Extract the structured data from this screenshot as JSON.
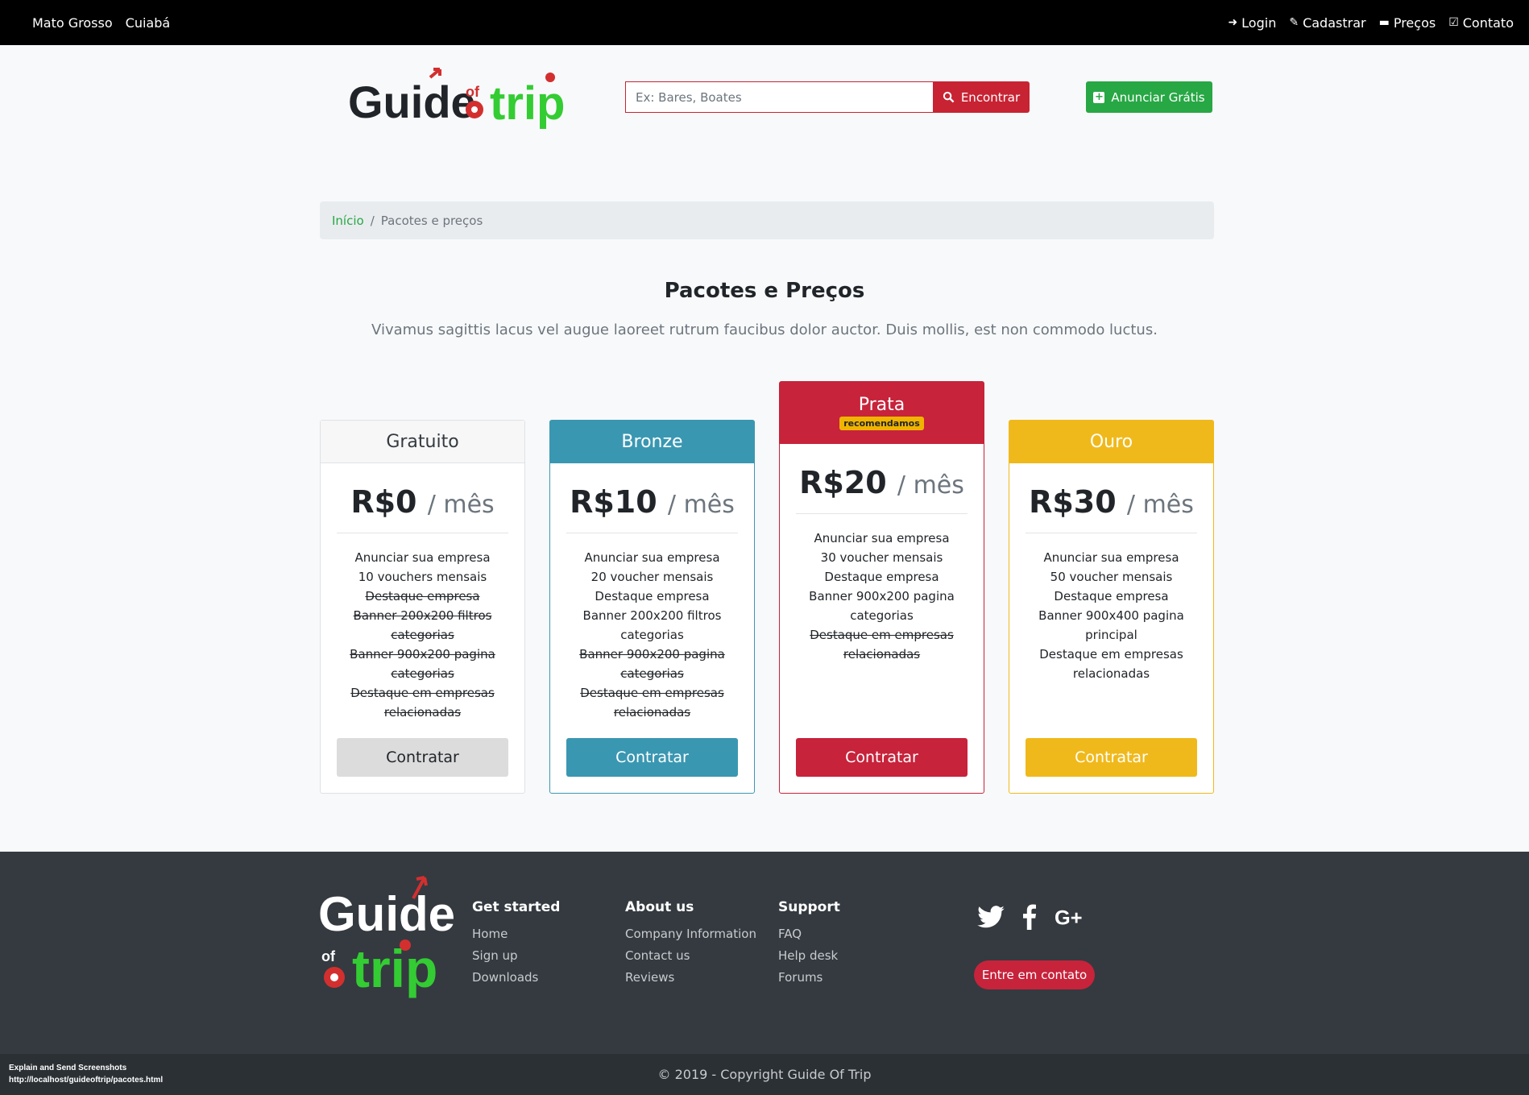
{
  "topbar": {
    "state": "Mato Grosso",
    "city": "Cuiabá",
    "nav": [
      "Login",
      "Cadastrar",
      "Preços",
      "Contato"
    ]
  },
  "logo": {
    "word1": "Guide",
    "word2": "of",
    "word3": "trip"
  },
  "search": {
    "placeholder": "Ex: Bares, Boates",
    "button": "Encontrar"
  },
  "announce": {
    "label": "Anunciar Grátis"
  },
  "breadcrumb": {
    "home": "Início",
    "sep": "/",
    "current": "Pacotes e preços"
  },
  "page": {
    "title": "Pacotes e Preços",
    "subtitle": "Vivamus sagittis lacus vel augue laoreet rutrum faucibus dolor auctor. Duis mollis, est non commodo luctus."
  },
  "plans": [
    {
      "name": "Gratuito",
      "price": "R$0",
      "per": "/ mês",
      "button": "Contratar",
      "features": [
        {
          "text": "Anunciar sua empresa",
          "off": false
        },
        {
          "text": "10 vouchers mensais",
          "off": false
        },
        {
          "text": "Destaque empresa",
          "off": true
        },
        {
          "text": "Banner 200x200 filtros categorias",
          "off": true
        },
        {
          "text": "Banner 900x200 pagina categorias",
          "off": true
        },
        {
          "text": "Destaque em empresas relacionadas",
          "off": true
        }
      ]
    },
    {
      "name": "Bronze",
      "price": "R$10",
      "per": "/ mês",
      "button": "Contratar",
      "features": [
        {
          "text": "Anunciar sua empresa",
          "off": false
        },
        {
          "text": "20 voucher mensais",
          "off": false
        },
        {
          "text": "Destaque empresa",
          "off": false
        },
        {
          "text": "Banner 200x200 filtros categorias",
          "off": false
        },
        {
          "text": "Banner 900x200 pagina categorias",
          "off": true
        },
        {
          "text": "Destaque em empresas relacionadas",
          "off": true
        }
      ]
    },
    {
      "name": "Prata",
      "badge": "recomendamos",
      "price": "R$20",
      "per": "/ mês",
      "button": "Contratar",
      "features": [
        {
          "text": "Anunciar sua empresa",
          "off": false
        },
        {
          "text": "30 voucher mensais",
          "off": false
        },
        {
          "text": "Destaque empresa",
          "off": false
        },
        {
          "text": "Banner 900x200 pagina categorias",
          "off": false
        },
        {
          "text": "Destaque em empresas relacionadas",
          "off": true
        }
      ]
    },
    {
      "name": "Ouro",
      "price": "R$30",
      "per": "/ mês",
      "button": "Contratar",
      "features": [
        {
          "text": "Anunciar sua empresa",
          "off": false
        },
        {
          "text": "50 voucher mensais",
          "off": false
        },
        {
          "text": "Destaque empresa",
          "off": false
        },
        {
          "text": "Banner 900x400 pagina principal",
          "off": false
        },
        {
          "text": "Destaque em empresas relacionadas",
          "off": false
        }
      ]
    }
  ],
  "footer": {
    "columns": [
      {
        "title": "Get started",
        "links": [
          "Home",
          "Sign up",
          "Downloads"
        ]
      },
      {
        "title": "About us",
        "links": [
          "Company Information",
          "Contact us",
          "Reviews"
        ]
      },
      {
        "title": "Support",
        "links": [
          "FAQ",
          "Help desk",
          "Forums"
        ]
      }
    ],
    "social": [
      "twitter-icon",
      "facebook-icon",
      "google-plus-icon"
    ],
    "contact_button": "Entre em contato",
    "copyright": "© 2019 - Copyright Guide Of Trip"
  },
  "overlay": {
    "line1": "Explain and Send Screenshots",
    "line2": "http://localhost/guideoftrip/pacotes.html"
  },
  "colors": {
    "brand_red": "#c7233b",
    "brand_green": "#28a745",
    "bronze": "#3a97b1",
    "gold": "#f0b91b",
    "footer_bg": "#343a40"
  }
}
